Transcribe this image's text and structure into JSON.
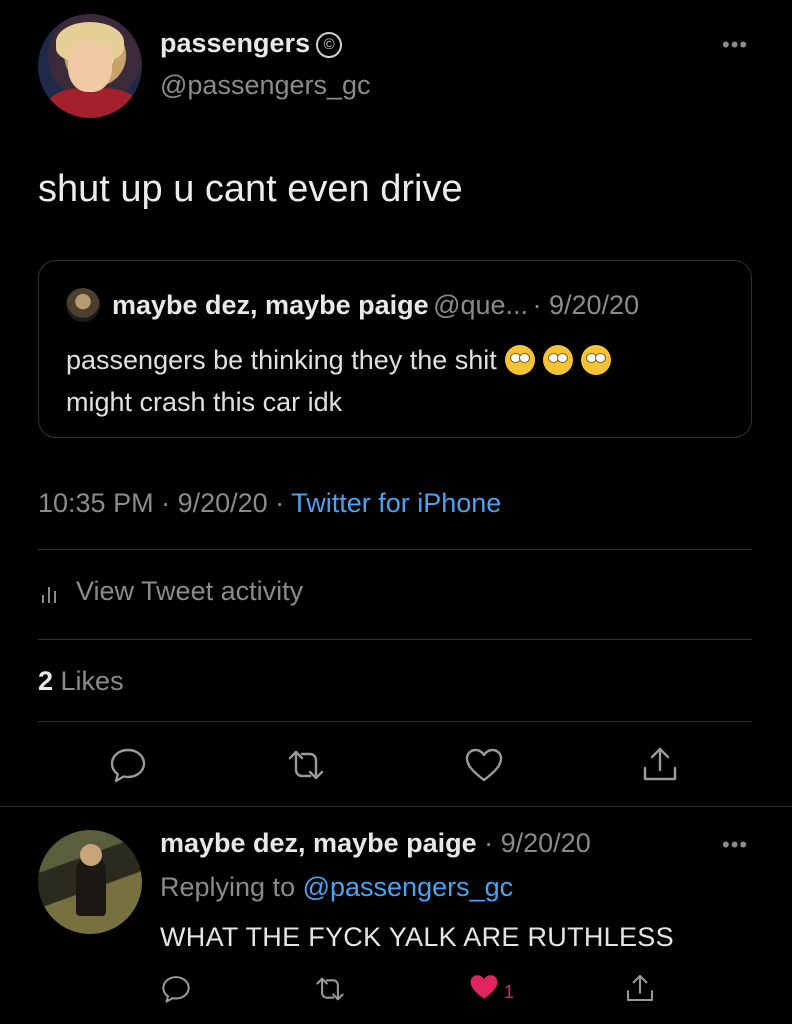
{
  "main_tweet": {
    "author_name": "passengers",
    "author_badge_icon": "copyright-icon",
    "author_handle": "@passengers_gc",
    "more_icon": "•••",
    "text": "shut up u cant even drive",
    "quote": {
      "author_name": "maybe dez, maybe paige",
      "author_handle": "@que...",
      "date": "· 9/20/20",
      "text_line1": "passengers be thinking they the shit",
      "emoji_icon": "face-with-rolling-eyes-icon",
      "text_line2": "might crash this car idk"
    },
    "time": "10:35 PM",
    "sep1": " · ",
    "date": "9/20/20",
    "sep2": " · ",
    "source": "Twitter for iPhone",
    "activity_label": "View Tweet activity",
    "likes_count": "2",
    "likes_label": " Likes"
  },
  "actions": {
    "reply_icon": "reply-icon",
    "retweet_icon": "retweet-icon",
    "like_icon": "heart-icon",
    "share_icon": "share-icon"
  },
  "reply": {
    "author_name": "maybe dez, maybe paige",
    "date": " · 9/20/20",
    "more_icon": "•••",
    "replying_label": "Replying to ",
    "replying_handle": "@passengers_gc",
    "text": "WHAT THE FYCK YALK ARE RUTHLESS",
    "like_count": "1"
  },
  "colors": {
    "background": "#000000",
    "link": "#4ba3f0",
    "like_active": "#e0245e",
    "muted": "#8b8b8b"
  }
}
